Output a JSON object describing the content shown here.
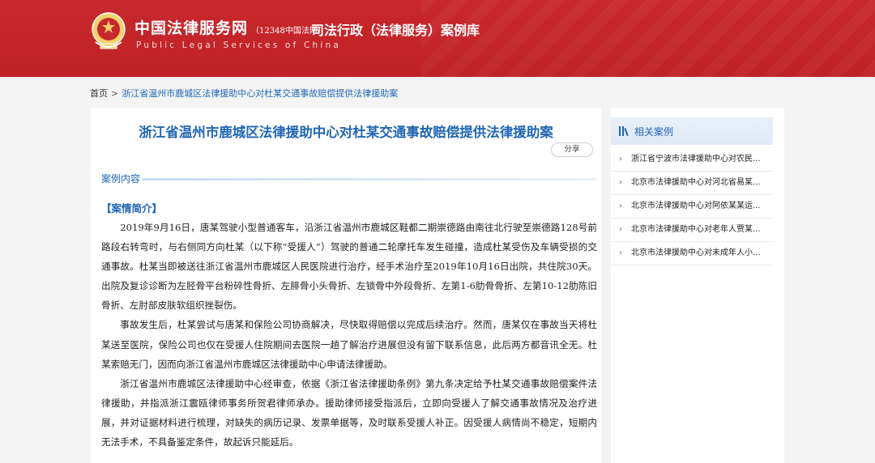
{
  "header": {
    "site_name": "中国法律服务网",
    "site_hotline": "（12348中国法网）",
    "site_name_en": "Public Legal Services of China",
    "section_title": "司法行政（法律服务）案例库"
  },
  "breadcrumb": {
    "home": "首页",
    "separator": ">",
    "current": "浙江省温州市鹿城区法律援助中心对杜某交通事故赔偿提供法律援助案"
  },
  "article": {
    "title": "浙江省温州市鹿城区法律援助中心对杜某交通事故赔偿提供法律援助案",
    "share_label": "分享",
    "section_label": "案例内容",
    "summary_heading": "【案情简介】",
    "paragraphs": [
      "2019年9月16日，唐某驾驶小型普通客车，沿浙江省温州市鹿城区鞋都二期崇德路由南往北行驶至崇德路128号前路段右转弯时，与右侧同方向杜某（以下称“受援人”）驾驶的普通二轮摩托车发生碰撞，造成杜某受伤及车辆受损的交通事故。杜某当即被送往浙江省温州市鹿城区人民医院进行治疗，经手术治疗至2019年10月16日出院，共住院30天。出院及复诊诊断为左胫骨平台粉碎性骨折、左腓骨小头骨折、左锁骨中外段骨折、左第1-6肋骨骨折、左第10-12肋陈旧骨折、左肘部皮肤软组织挫裂伤。",
      "事故发生后，杜某尝试与唐某和保险公司协商解决，尽快取得赔偿以完成后续治疗。然而，唐某仅在事故当天将杜某送至医院，保险公司也仅在受援人住院期间去医院一趟了解治疗进展但没有留下联系信息，此后两方都音讯全无。杜某索赔无门，因而向浙江省温州市鹿城区法律援助中心申请法律援助。",
      "浙江省温州市鹿城区法律援助中心经审查，依据《浙江省法律援助条例》第九条决定给予杜某交通事故赔偿案件法律援助，并指派浙江震瓯律师事务所贺君律师承办。援助律师接受指派后，立即向受援人了解交通事故情况及治疗进展，并对证据材料进行梳理，对缺失的病历记录、发票单据等，及时联系受援人补正。因受援人病情尚不稳定，短期内无法手术，不具备鉴定条件，故起诉只能延后。"
    ]
  },
  "related": {
    "title": "相关案例",
    "items": [
      "浙江省宁波市法律援助中心对农民...",
      "北京市法律援助中心对河北省易某...",
      "北京市法律援助中心对阿依某某运...",
      "北京市法律援助中心对老年人贾某...",
      "北京市法律援助中心对未成年人小..."
    ]
  },
  "colors": {
    "header_red": "#c8282c",
    "link_blue": "#1f66b5",
    "gutter_gray": "#f4f4f4"
  }
}
